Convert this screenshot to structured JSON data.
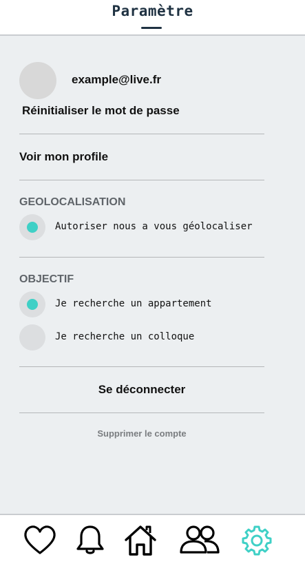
{
  "header": {
    "title": "Paramètre"
  },
  "profile": {
    "email": "example@live.fr",
    "reset_password": "Réinitialiser le mot de passe",
    "view_profile": "Voir mon profile"
  },
  "geolocation": {
    "title": "GEOLOCALISATION",
    "option": {
      "label": "Autoriser nous a vous géolocaliser",
      "selected": true
    }
  },
  "objective": {
    "title": "OBJECTIF",
    "options": [
      {
        "label": "Je recherche un appartement",
        "selected": true
      },
      {
        "label": "Je recherche un colloque",
        "selected": false
      }
    ]
  },
  "actions": {
    "logout": "Se déconnecter",
    "delete_account": "Supprimer le compte"
  },
  "bottom_nav": {
    "items": [
      {
        "icon": "heart-icon",
        "active": false
      },
      {
        "icon": "bell-icon",
        "active": false
      },
      {
        "icon": "home-icon",
        "active": false
      },
      {
        "icon": "users-icon",
        "active": false
      },
      {
        "icon": "gear-icon",
        "active": true
      }
    ]
  },
  "colors": {
    "accent": "#3fd0c6",
    "title": "#1f3242",
    "background": "#eceff1"
  }
}
